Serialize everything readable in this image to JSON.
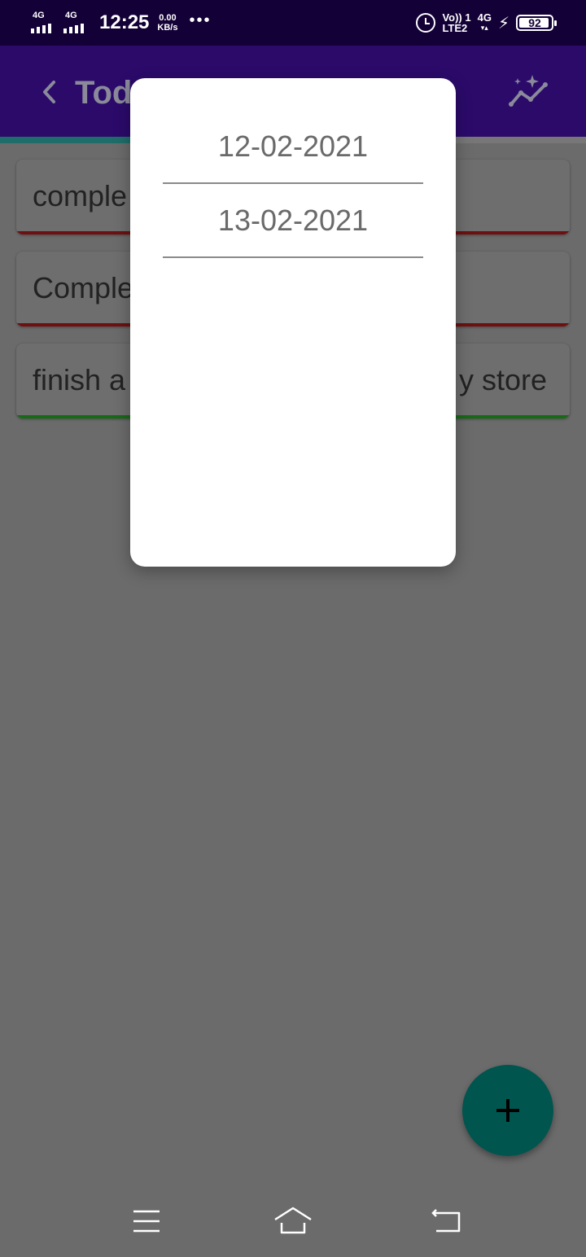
{
  "status_bar": {
    "network1": "4G",
    "network2": "4G",
    "time": "12:25",
    "speed_value": "0.00",
    "speed_unit": "KB/s",
    "more": "•••",
    "volte_top": "Vo)) 1",
    "volte_bottom": "LTE2",
    "net_right": "4G",
    "battery": "92"
  },
  "app_bar": {
    "title": "Tod",
    "background": "#2b0a6a"
  },
  "tasks": [
    {
      "left_text": "comple",
      "right_text": "",
      "status_color": "#b00000"
    },
    {
      "left_text": "Comple",
      "right_text": "",
      "status_color": "#b00000"
    },
    {
      "left_text": "finish a",
      "right_text": "y store",
      "status_color": "#23a023"
    }
  ],
  "dialog": {
    "dates": [
      "12-02-2021",
      "13-02-2021"
    ]
  },
  "fab": {
    "icon": "plus-icon",
    "color": "#00554f"
  },
  "nav": {
    "icons": [
      "menu-icon",
      "home-icon",
      "back-icon"
    ]
  }
}
